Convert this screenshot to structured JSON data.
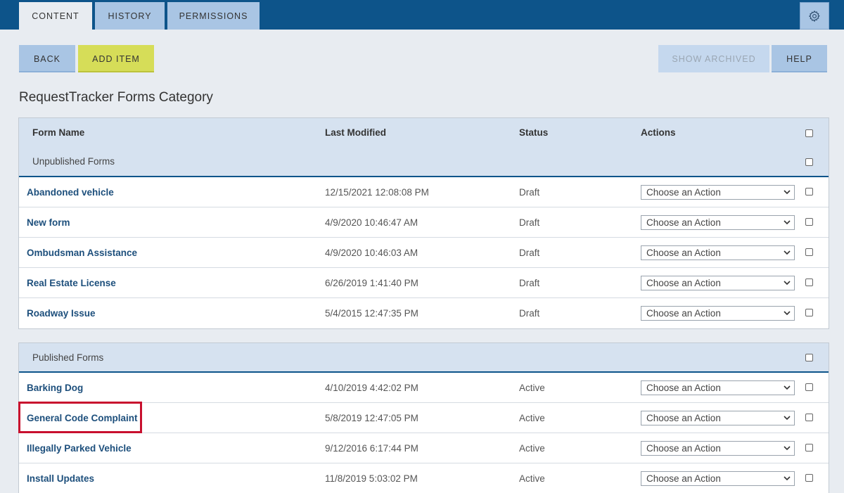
{
  "tabs": [
    {
      "label": "CONTENT",
      "active": true
    },
    {
      "label": "HISTORY",
      "active": false
    },
    {
      "label": "PERMISSIONS",
      "active": false
    }
  ],
  "settings_icon": "gear-icon",
  "toolbar": {
    "back_label": "BACK",
    "add_item_label": "ADD ITEM",
    "show_archived_label": "SHOW ARCHIVED",
    "help_label": "HELP"
  },
  "page_title": "RequestTracker Forms Category",
  "table": {
    "columns": [
      "Form Name",
      "Last Modified",
      "Status",
      "Actions"
    ],
    "action_placeholder": "Choose an Action",
    "groups": [
      {
        "label": "Unpublished Forms",
        "rows": [
          {
            "name": "Abandoned vehicle",
            "modified": "12/15/2021 12:08:08 PM",
            "status": "Draft"
          },
          {
            "name": "New form",
            "modified": "4/9/2020 10:46:47 AM",
            "status": "Draft"
          },
          {
            "name": "Ombudsman Assistance",
            "modified": "4/9/2020 10:46:03 AM",
            "status": "Draft"
          },
          {
            "name": "Real Estate License",
            "modified": "6/26/2019 1:41:40 PM",
            "status": "Draft"
          },
          {
            "name": "Roadway Issue",
            "modified": "5/4/2015 12:47:35 PM",
            "status": "Draft"
          }
        ]
      },
      {
        "label": "Published Forms",
        "rows": [
          {
            "name": "Barking Dog",
            "modified": "4/10/2019 4:42:02 PM",
            "status": "Active"
          },
          {
            "name": "General Code Complaint",
            "modified": "5/8/2019 12:47:05 PM",
            "status": "Active"
          },
          {
            "name": "Illegally Parked Vehicle",
            "modified": "9/12/2016 6:17:44 PM",
            "status": "Active"
          },
          {
            "name": "Install Updates",
            "modified": "11/8/2019 5:03:02 PM",
            "status": "Active"
          }
        ]
      }
    ]
  },
  "colors": {
    "topbar": "#0d548a",
    "tab_inactive": "#a9c5e4",
    "add_item": "#d6dd58",
    "link": "#1d4f7c",
    "highlight": "#c8102e"
  }
}
